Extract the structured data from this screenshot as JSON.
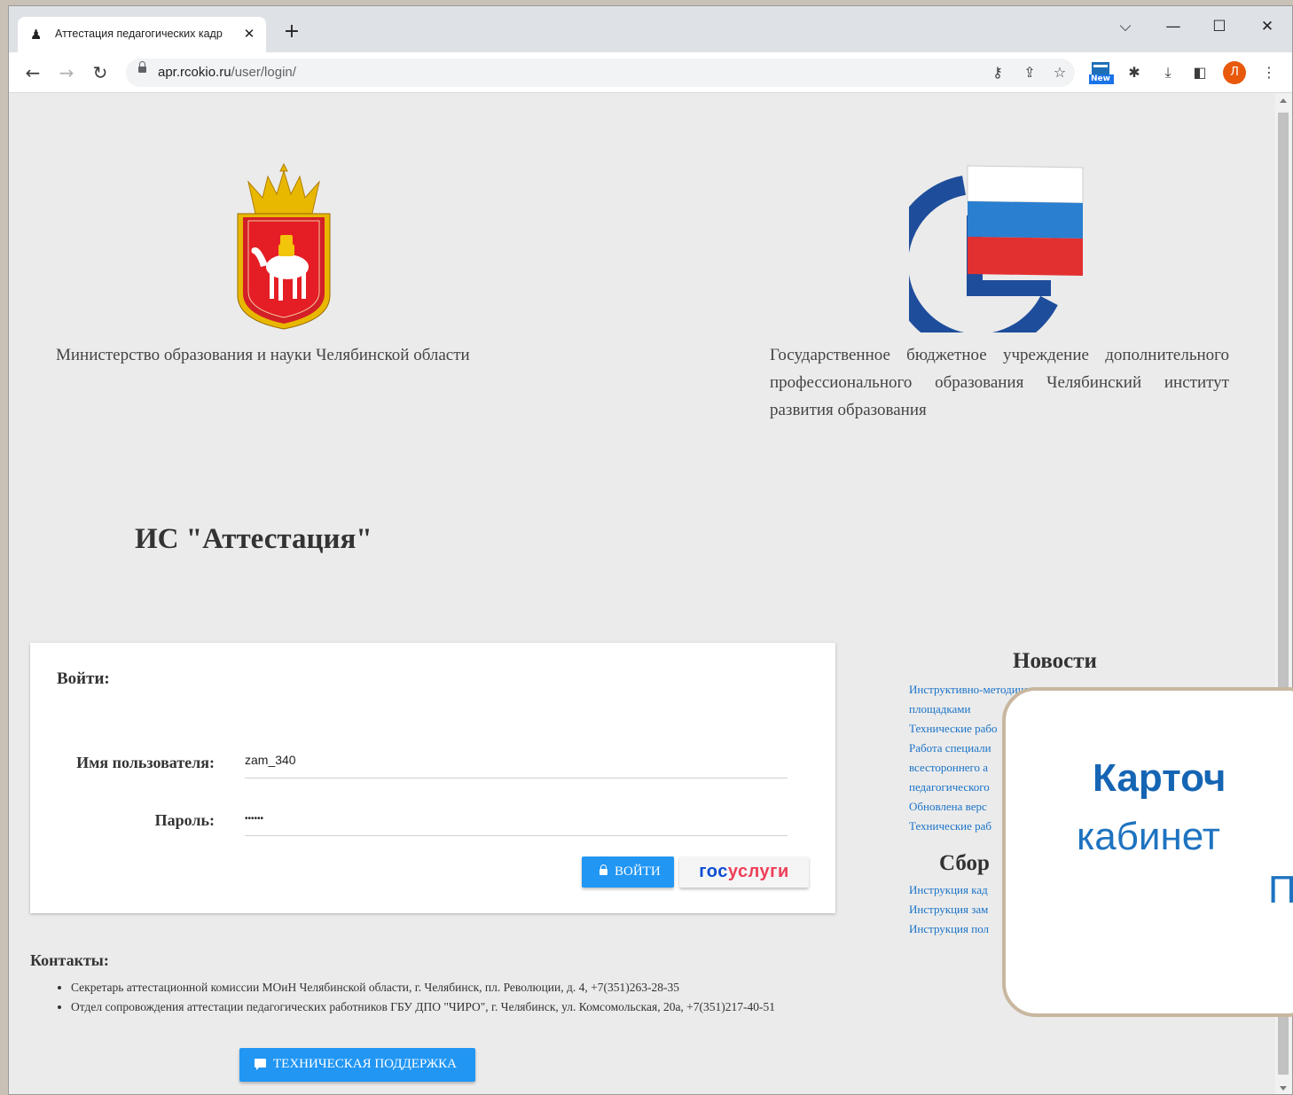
{
  "browser": {
    "tab_title": "Аттестация педагогических кадр",
    "tab_close": "✕",
    "new_tab": "+",
    "url_host": "apr.rcokio.ru",
    "url_path": "/user/login/",
    "profile_initial": "Л",
    "ext_badge": "New",
    "window_controls": {
      "dropdown": "⌵",
      "minimize": "—",
      "maximize": "☐",
      "close": "✕"
    }
  },
  "org_left": {
    "text": "Министерство образования и науки Челябинской области",
    "emblem": "chelyabinsk-coat-of-arms"
  },
  "org_right": {
    "text": "Государственное бюджетное учреждение дополнительного профессионального образования Челябинский институт развития образования",
    "emblem": "chiro-logo"
  },
  "app_name": "ИС \"Аттестация\"",
  "login": {
    "heading": "Войти:",
    "username_label": "Имя пользователя:",
    "username_value": "zam_340",
    "password_label": "Пароль:",
    "password_value": "••••••",
    "login_button": "ВОЙТИ",
    "gosuslugi_part1": "гос",
    "gosuslugi_part2": "услуги"
  },
  "contacts": {
    "heading": "Контакты:",
    "items": [
      "Секретарь аттестационной комиссии МОиН Челябинской области, г. Челябинск, пл. Революции, д. 4, +7(351)263-28-35",
      "Отдел сопровождения аттестации педагогических работников ГБУ ДПО \"ЧИРО\", г. Челябинск, ул. Комсомольская, 20а, +7(351)217-40-51"
    ],
    "support_button": "ТЕХНИЧЕСКАЯ ПОДДЕРЖКА"
  },
  "news": {
    "heading": "Новости",
    "items": [
      "Инструктивно-методичес",
      "площадками",
      "Технические рабо",
      "Работа специали",
      "всестороннего а",
      "педагогического",
      "Обновлена верс",
      "Технические раб"
    ]
  },
  "collections": {
    "heading": "Сбор",
    "items": [
      "Инструкция кад",
      "Инструкция зам",
      "Инструкция пол"
    ]
  },
  "overlay": {
    "line1": "Карточ",
    "line2": "кабинет",
    "line3": "П"
  },
  "colors": {
    "accent_blue": "#2196f3",
    "link_blue": "#1a73c8",
    "overlay_border": "#c8b79f",
    "profile_orange": "#e8590c"
  }
}
